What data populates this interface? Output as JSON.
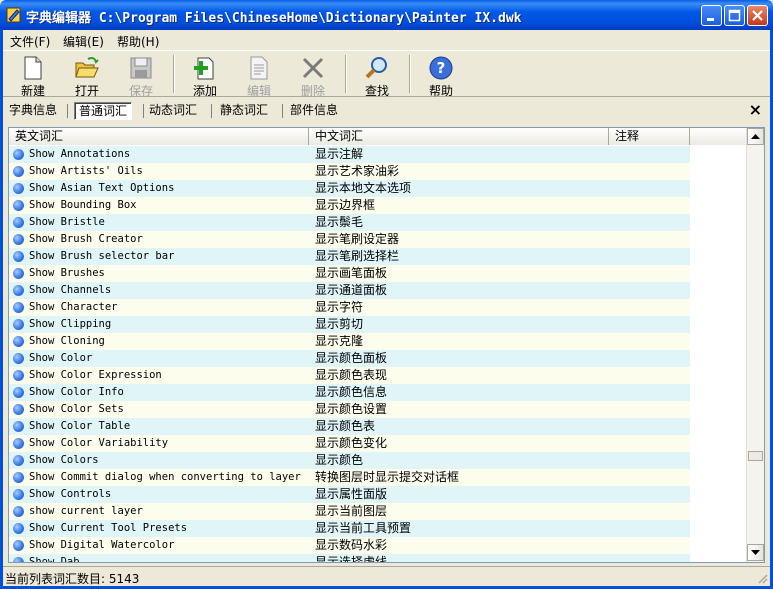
{
  "window": {
    "title": "字典编辑器 C:\\Program Files\\ChineseHome\\Dictionary\\Painter IX.dwk"
  },
  "menu": {
    "file": "文件(F)",
    "edit": "编辑(E)",
    "help": "帮助(H)"
  },
  "toolbar": {
    "new": "新建",
    "open": "打开",
    "save": "保存",
    "add": "添加",
    "edit": "编辑",
    "delete": "删除",
    "find": "查找",
    "help": "帮助"
  },
  "tabs": {
    "dict_info": "字典信息",
    "common": "普通词汇",
    "dynamic": "动态词汇",
    "static": "静态词汇",
    "parts": "部件信息"
  },
  "list": {
    "headers": {
      "english": "英文词汇",
      "chinese": "中文词汇",
      "note": "注释"
    },
    "rows": [
      {
        "en": "Show Annotations",
        "zh": "显示注解"
      },
      {
        "en": "Show Artists' Oils",
        "zh": "显示艺术家油彩"
      },
      {
        "en": "Show Asian Text Options",
        "zh": "显示本地文本选项"
      },
      {
        "en": "Show Bounding Box",
        "zh": "显示边界框"
      },
      {
        "en": "Show Bristle",
        "zh": "显示鬃毛"
      },
      {
        "en": "Show Brush Creator",
        "zh": "显示笔刷设定器"
      },
      {
        "en": "Show Brush selector bar",
        "zh": "显示笔刷选择栏"
      },
      {
        "en": "Show Brushes",
        "zh": "显示画笔面板"
      },
      {
        "en": "Show Channels",
        "zh": "显示通道面板"
      },
      {
        "en": "Show Character",
        "zh": "显示字符"
      },
      {
        "en": "Show Clipping",
        "zh": "显示剪切"
      },
      {
        "en": "Show Cloning",
        "zh": "显示克隆"
      },
      {
        "en": "Show Color",
        "zh": "显示颜色面板"
      },
      {
        "en": "Show Color Expression",
        "zh": "显示颜色表现"
      },
      {
        "en": "Show Color Info",
        "zh": "显示颜色信息"
      },
      {
        "en": "Show Color Sets",
        "zh": "显示颜色设置"
      },
      {
        "en": "Show Color Table",
        "zh": "显示颜色表"
      },
      {
        "en": "Show Color Variability",
        "zh": "显示颜色变化"
      },
      {
        "en": "Show Colors",
        "zh": "显示颜色"
      },
      {
        "en": "Show Commit dialog when converting to layer",
        "zh": "转换图层时显示提交对话框"
      },
      {
        "en": "Show Controls",
        "zh": "显示属性面版"
      },
      {
        "en": "show current layer",
        "zh": "显示当前图层"
      },
      {
        "en": "Show Current Tool Presets",
        "zh": "显示当前工具预置"
      },
      {
        "en": "Show Digital Watercolor",
        "zh": "显示数码水彩"
      },
      {
        "en": "Show Dab",
        "zh": "显示选择虚线"
      }
    ]
  },
  "status": {
    "count_text": "当前列表词汇数目: 5143"
  },
  "colors": {
    "title_bar": "#0054e3",
    "row_alt": "#dff5f8",
    "row_norm": "#fdfdee"
  }
}
